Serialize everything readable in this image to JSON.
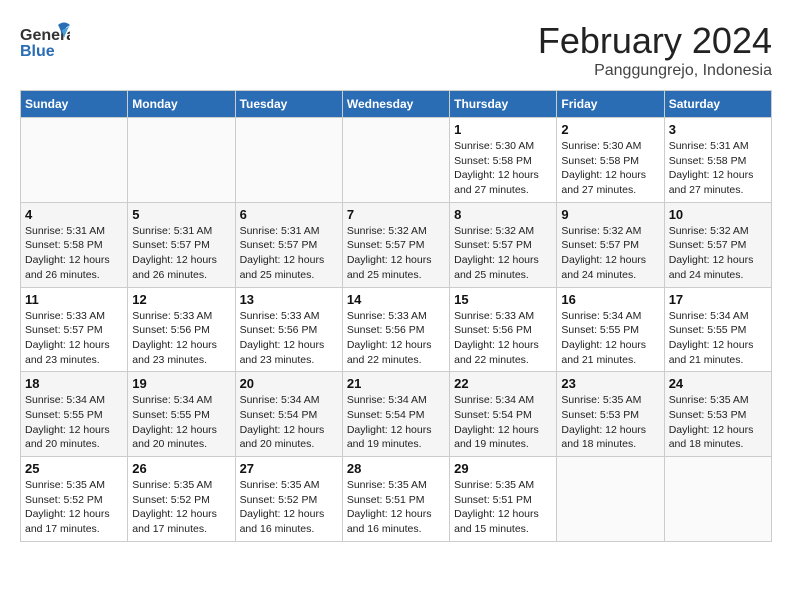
{
  "header": {
    "logo_line1": "General",
    "logo_line2": "Blue",
    "month": "February 2024",
    "location": "Panggungrejo, Indonesia"
  },
  "weekdays": [
    "Sunday",
    "Monday",
    "Tuesday",
    "Wednesday",
    "Thursday",
    "Friday",
    "Saturday"
  ],
  "weeks": [
    [
      {
        "day": "",
        "info": ""
      },
      {
        "day": "",
        "info": ""
      },
      {
        "day": "",
        "info": ""
      },
      {
        "day": "",
        "info": ""
      },
      {
        "day": "1",
        "info": "Sunrise: 5:30 AM\nSunset: 5:58 PM\nDaylight: 12 hours\nand 27 minutes."
      },
      {
        "day": "2",
        "info": "Sunrise: 5:30 AM\nSunset: 5:58 PM\nDaylight: 12 hours\nand 27 minutes."
      },
      {
        "day": "3",
        "info": "Sunrise: 5:31 AM\nSunset: 5:58 PM\nDaylight: 12 hours\nand 27 minutes."
      }
    ],
    [
      {
        "day": "4",
        "info": "Sunrise: 5:31 AM\nSunset: 5:58 PM\nDaylight: 12 hours\nand 26 minutes."
      },
      {
        "day": "5",
        "info": "Sunrise: 5:31 AM\nSunset: 5:57 PM\nDaylight: 12 hours\nand 26 minutes."
      },
      {
        "day": "6",
        "info": "Sunrise: 5:31 AM\nSunset: 5:57 PM\nDaylight: 12 hours\nand 25 minutes."
      },
      {
        "day": "7",
        "info": "Sunrise: 5:32 AM\nSunset: 5:57 PM\nDaylight: 12 hours\nand 25 minutes."
      },
      {
        "day": "8",
        "info": "Sunrise: 5:32 AM\nSunset: 5:57 PM\nDaylight: 12 hours\nand 25 minutes."
      },
      {
        "day": "9",
        "info": "Sunrise: 5:32 AM\nSunset: 5:57 PM\nDaylight: 12 hours\nand 24 minutes."
      },
      {
        "day": "10",
        "info": "Sunrise: 5:32 AM\nSunset: 5:57 PM\nDaylight: 12 hours\nand 24 minutes."
      }
    ],
    [
      {
        "day": "11",
        "info": "Sunrise: 5:33 AM\nSunset: 5:57 PM\nDaylight: 12 hours\nand 23 minutes."
      },
      {
        "day": "12",
        "info": "Sunrise: 5:33 AM\nSunset: 5:56 PM\nDaylight: 12 hours\nand 23 minutes."
      },
      {
        "day": "13",
        "info": "Sunrise: 5:33 AM\nSunset: 5:56 PM\nDaylight: 12 hours\nand 23 minutes."
      },
      {
        "day": "14",
        "info": "Sunrise: 5:33 AM\nSunset: 5:56 PM\nDaylight: 12 hours\nand 22 minutes."
      },
      {
        "day": "15",
        "info": "Sunrise: 5:33 AM\nSunset: 5:56 PM\nDaylight: 12 hours\nand 22 minutes."
      },
      {
        "day": "16",
        "info": "Sunrise: 5:34 AM\nSunset: 5:55 PM\nDaylight: 12 hours\nand 21 minutes."
      },
      {
        "day": "17",
        "info": "Sunrise: 5:34 AM\nSunset: 5:55 PM\nDaylight: 12 hours\nand 21 minutes."
      }
    ],
    [
      {
        "day": "18",
        "info": "Sunrise: 5:34 AM\nSunset: 5:55 PM\nDaylight: 12 hours\nand 20 minutes."
      },
      {
        "day": "19",
        "info": "Sunrise: 5:34 AM\nSunset: 5:55 PM\nDaylight: 12 hours\nand 20 minutes."
      },
      {
        "day": "20",
        "info": "Sunrise: 5:34 AM\nSunset: 5:54 PM\nDaylight: 12 hours\nand 20 minutes."
      },
      {
        "day": "21",
        "info": "Sunrise: 5:34 AM\nSunset: 5:54 PM\nDaylight: 12 hours\nand 19 minutes."
      },
      {
        "day": "22",
        "info": "Sunrise: 5:34 AM\nSunset: 5:54 PM\nDaylight: 12 hours\nand 19 minutes."
      },
      {
        "day": "23",
        "info": "Sunrise: 5:35 AM\nSunset: 5:53 PM\nDaylight: 12 hours\nand 18 minutes."
      },
      {
        "day": "24",
        "info": "Sunrise: 5:35 AM\nSunset: 5:53 PM\nDaylight: 12 hours\nand 18 minutes."
      }
    ],
    [
      {
        "day": "25",
        "info": "Sunrise: 5:35 AM\nSunset: 5:52 PM\nDaylight: 12 hours\nand 17 minutes."
      },
      {
        "day": "26",
        "info": "Sunrise: 5:35 AM\nSunset: 5:52 PM\nDaylight: 12 hours\nand 17 minutes."
      },
      {
        "day": "27",
        "info": "Sunrise: 5:35 AM\nSunset: 5:52 PM\nDaylight: 12 hours\nand 16 minutes."
      },
      {
        "day": "28",
        "info": "Sunrise: 5:35 AM\nSunset: 5:51 PM\nDaylight: 12 hours\nand 16 minutes."
      },
      {
        "day": "29",
        "info": "Sunrise: 5:35 AM\nSunset: 5:51 PM\nDaylight: 12 hours\nand 15 minutes."
      },
      {
        "day": "",
        "info": ""
      },
      {
        "day": "",
        "info": ""
      }
    ]
  ]
}
